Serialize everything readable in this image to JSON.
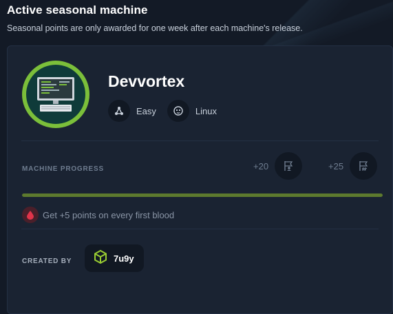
{
  "header": {
    "title": "Active seasonal machine",
    "subtitle": "Seasonal points are only awarded for one week after each machine's release."
  },
  "machine": {
    "name": "Devvortex",
    "logo_icon": "computer-monitor-icon",
    "difficulty": {
      "label": "Easy",
      "icon": "difficulty-nodes-icon"
    },
    "os": {
      "label": "Linux",
      "icon": "linux-tux-icon"
    }
  },
  "progress": {
    "label": "MACHINE PROGRESS",
    "fill_percent": 100,
    "user_points": {
      "value": "+20",
      "icon": "user-flag-icon"
    },
    "root_points": {
      "value": "+25",
      "icon": "root-flag-icon"
    }
  },
  "blood": {
    "text": "Get +5 points on every first blood",
    "icon": "blood-drop-icon"
  },
  "creator": {
    "label": "CREATED BY",
    "name": "7u9y",
    "icon": "cube-icon"
  },
  "colors": {
    "background": "#131a26",
    "card": "#1a2332",
    "accent_green": "#7bbf3a",
    "progress_fill": "#5d7a2e",
    "blood_red": "#e0344a"
  }
}
